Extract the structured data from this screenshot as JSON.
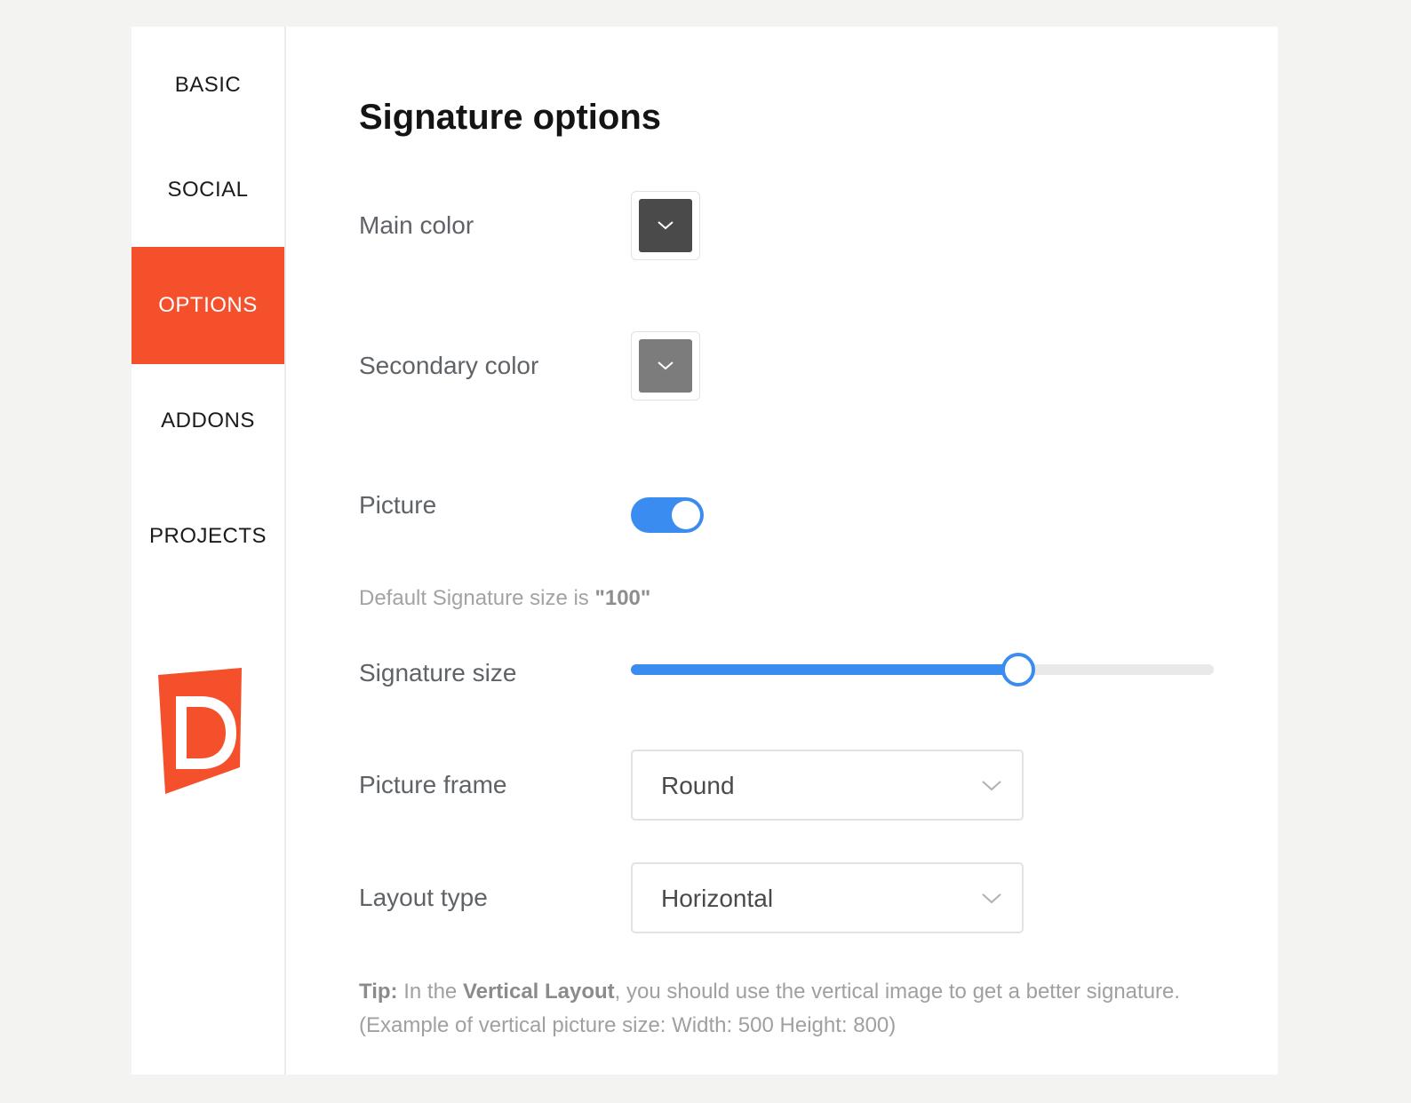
{
  "sidebar": {
    "items": [
      {
        "label": "BASIC",
        "active": false
      },
      {
        "label": "SOCIAL",
        "active": false
      },
      {
        "label": "OPTIONS",
        "active": true
      },
      {
        "label": "ADDONS",
        "active": false
      },
      {
        "label": "PROJECTS",
        "active": false
      }
    ],
    "logo": {
      "letter": "D",
      "color": "#f4502c"
    }
  },
  "main": {
    "title": "Signature options",
    "main_color": {
      "label": "Main color",
      "value": "#4a4a4a",
      "icon": "chevron-down-icon"
    },
    "secondary_color": {
      "label": "Secondary color",
      "value": "#7c7c7c",
      "icon": "chevron-down-icon"
    },
    "picture": {
      "label": "Picture",
      "enabled": true,
      "color": "#3b8cf0"
    },
    "size_hint": {
      "prefix": "Default Signature size is ",
      "value": "\"100\""
    },
    "signature_size": {
      "label": "Signature size",
      "fraction": 0.665,
      "color": "#3b8cf0"
    },
    "picture_frame": {
      "label": "Picture frame",
      "value": "Round"
    },
    "layout_type": {
      "label": "Layout type",
      "value": "Horizontal"
    },
    "tip": {
      "strong": "Tip:",
      "part1": " In the ",
      "emphasis": "Vertical Layout",
      "part2": ", you should use the vertical image to get a better signature.",
      "line2": "(Example of vertical picture size: Width: 500 Height: 800)"
    }
  }
}
